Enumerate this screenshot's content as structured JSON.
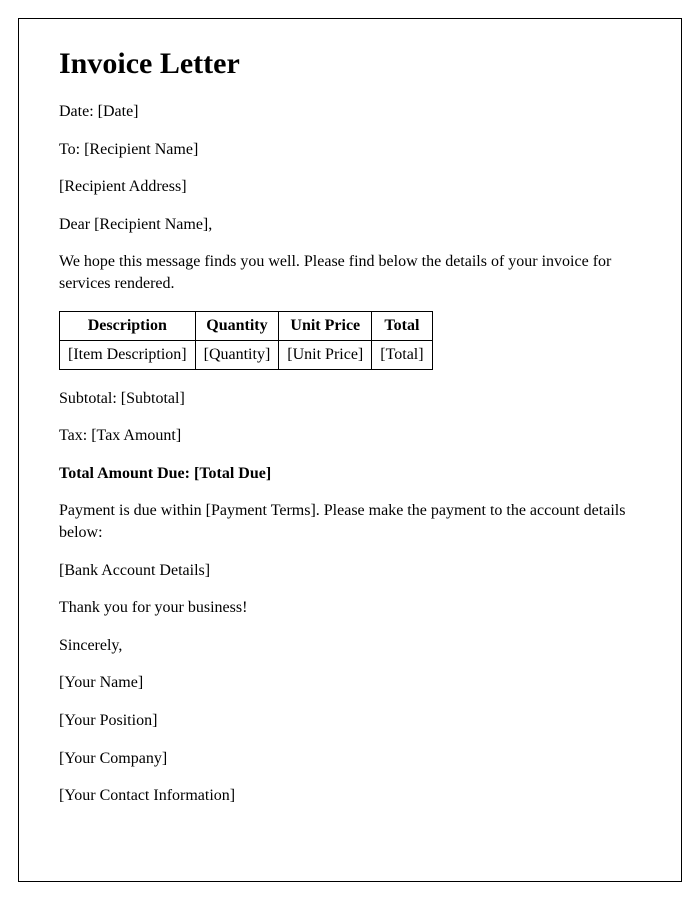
{
  "title": "Invoice Letter",
  "date_line": "Date: [Date]",
  "to_line": "To: [Recipient Name]",
  "recipient_address": "[Recipient Address]",
  "salutation": "Dear [Recipient Name],",
  "intro": "We hope this message finds you well. Please find below the details of your invoice for services rendered.",
  "table": {
    "headers": [
      "Description",
      "Quantity",
      "Unit Price",
      "Total"
    ],
    "row": [
      "[Item Description]",
      "[Quantity]",
      "[Unit Price]",
      "[Total]"
    ]
  },
  "subtotal": "Subtotal: [Subtotal]",
  "tax": "Tax: [Tax Amount]",
  "total_due": "Total Amount Due: [Total Due]",
  "payment_terms": "Payment is due within [Payment Terms]. Please make the payment to the account details below:",
  "bank_details": "[Bank Account Details]",
  "thank_you": "Thank you for your business!",
  "closing": "Sincerely,",
  "your_name": "[Your Name]",
  "your_position": "[Your Position]",
  "your_company": "[Your Company]",
  "your_contact": "[Your Contact Information]"
}
